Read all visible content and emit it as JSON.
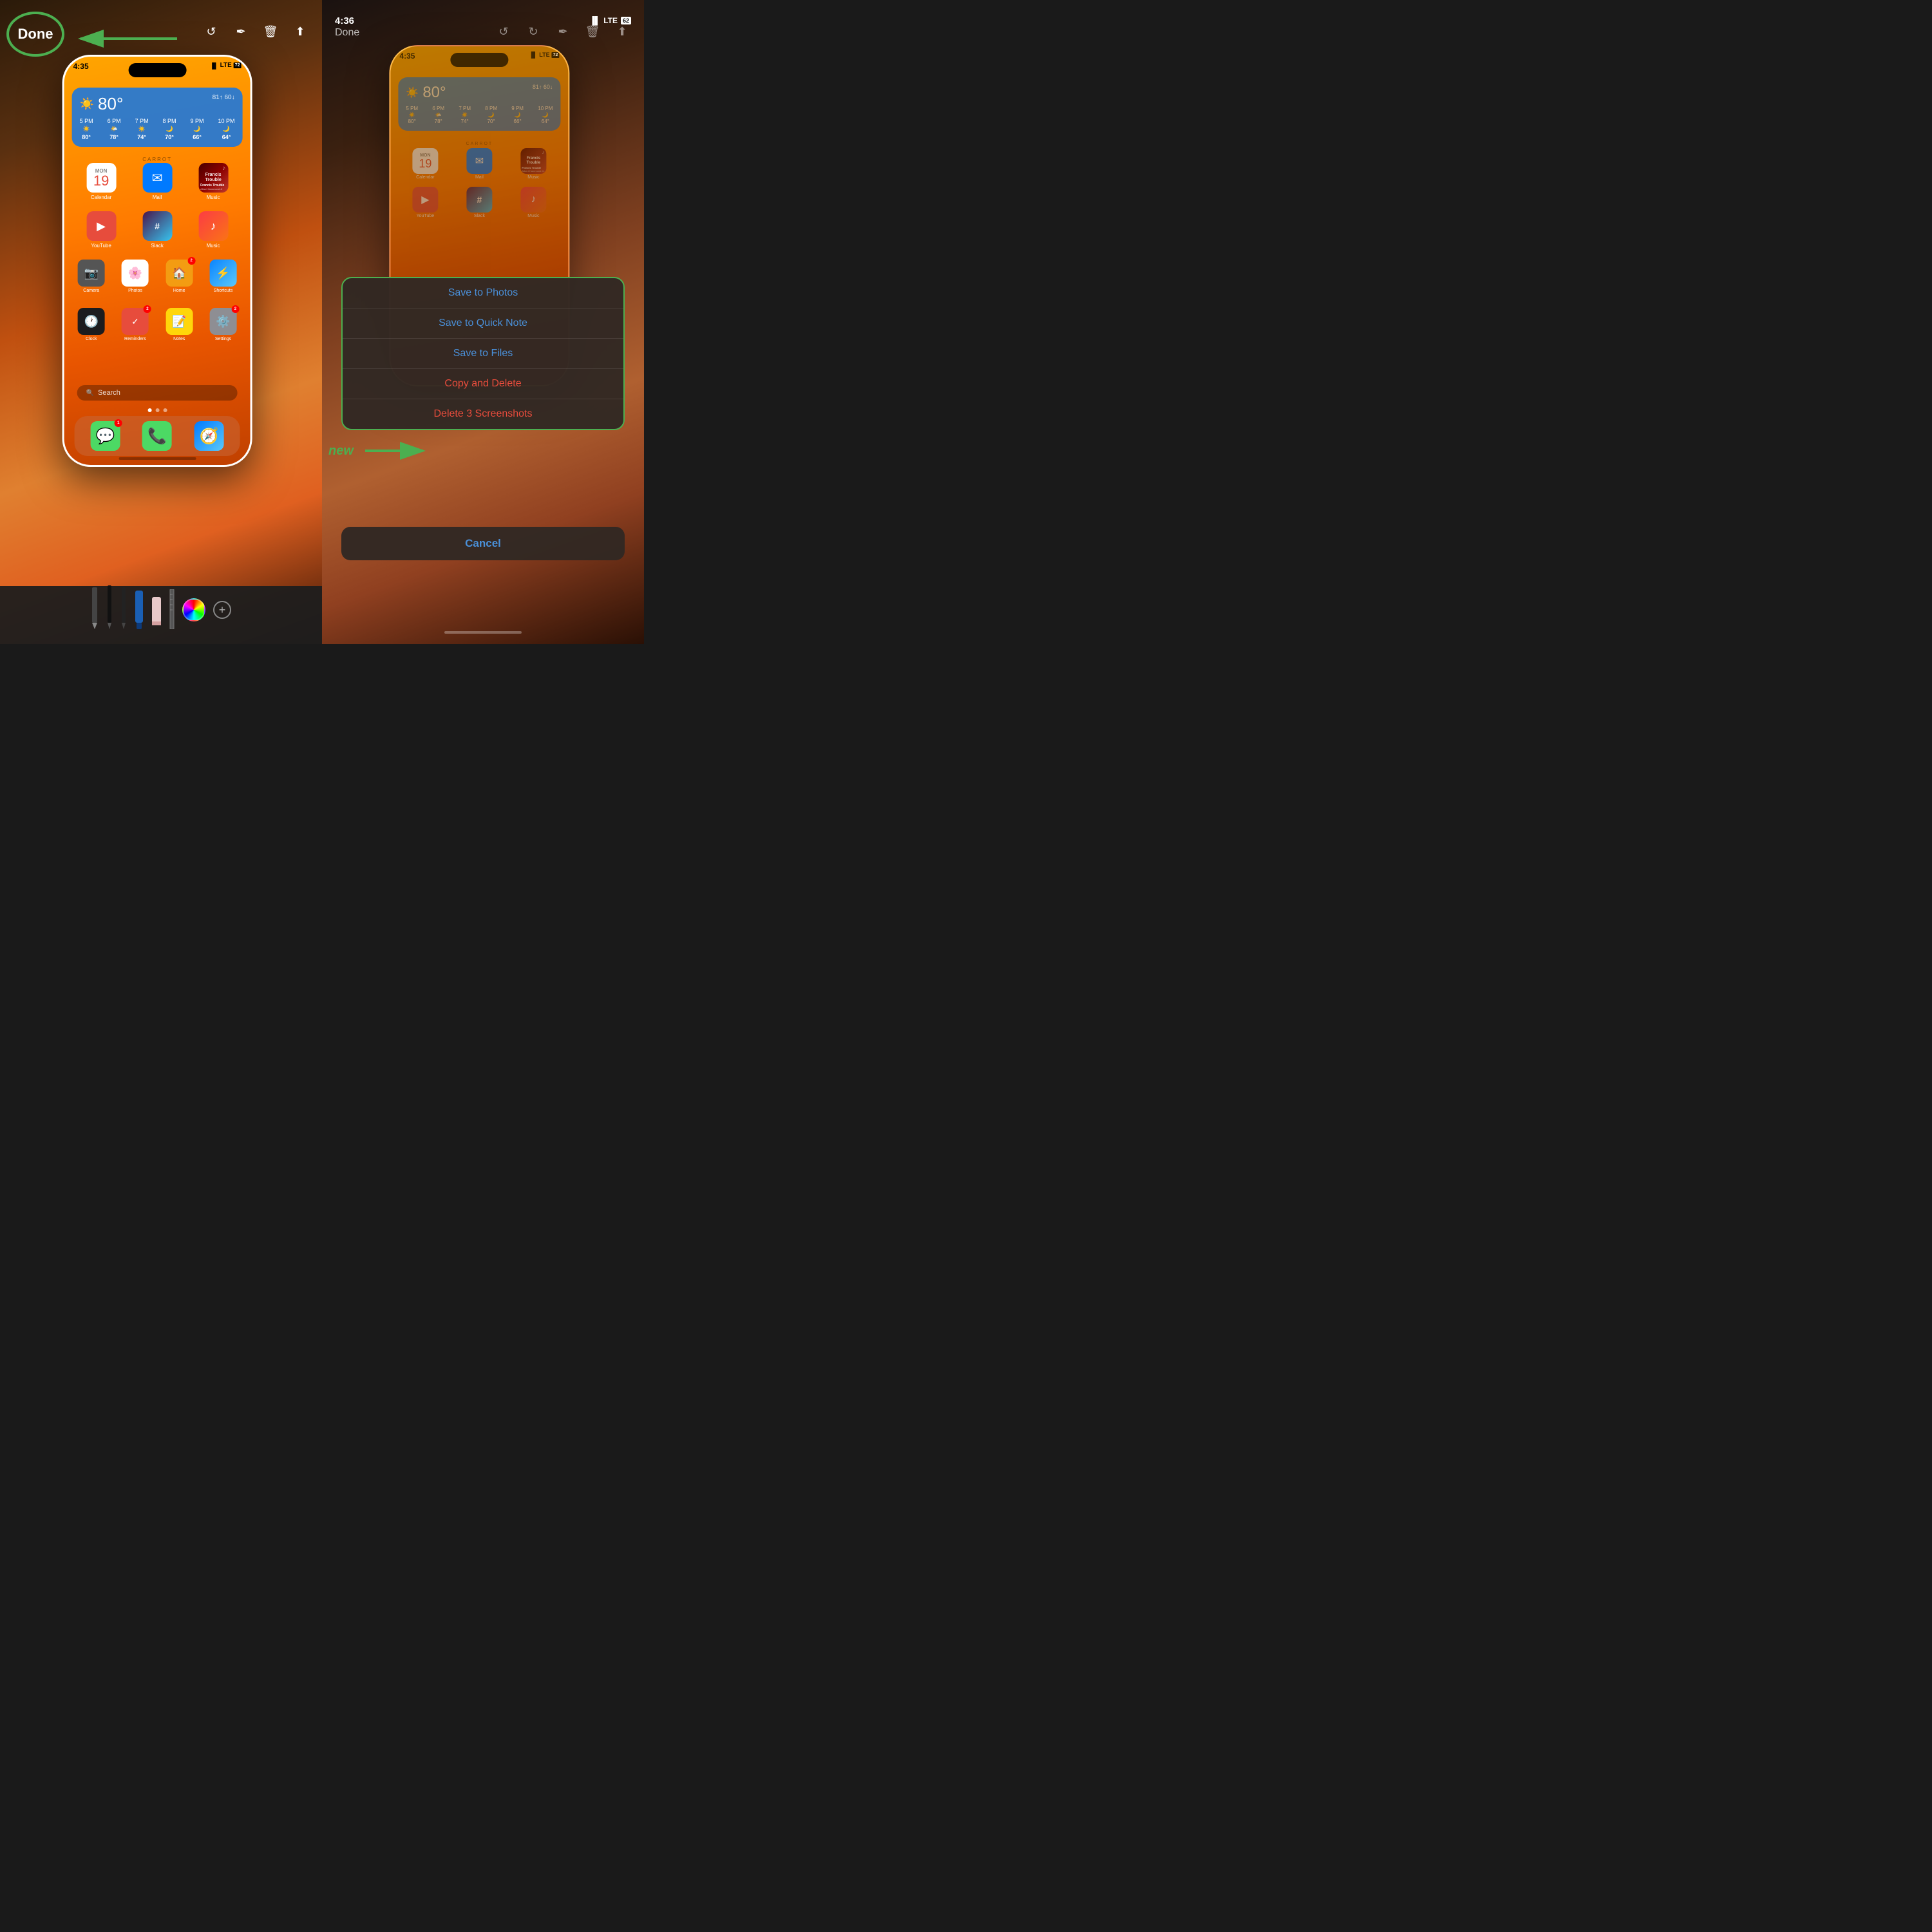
{
  "left_panel": {
    "status_time": "4:35",
    "status_signal": "LTE",
    "status_battery": "72",
    "toolbar": {
      "done_label": "Done",
      "icons": [
        "rotate-left",
        "pen",
        "trash",
        "share"
      ]
    },
    "done_circle_label": "Done",
    "phone": {
      "time": "4:35",
      "weather": {
        "temp": "80°",
        "icon": "☀️",
        "high": "81↑",
        "low": "60↓",
        "label": "CARROT",
        "forecast": [
          {
            "time": "5 PM",
            "icon": "☀️",
            "temp": "80°"
          },
          {
            "time": "6 PM",
            "icon": "🌤️",
            "temp": "78°"
          },
          {
            "time": "7 PM",
            "icon": "☀️",
            "temp": "74°"
          },
          {
            "time": "8 PM",
            "icon": "🌙",
            "temp": "70°"
          },
          {
            "time": "9 PM",
            "icon": "🌙",
            "temp": "66°"
          },
          {
            "time": "10 PM",
            "icon": "🌙",
            "temp": "64°"
          }
        ]
      },
      "apps_row1": [
        {
          "name": "Calendar",
          "label": "Calendar",
          "day": "MON",
          "num": "19"
        },
        {
          "name": "Mail",
          "label": "Mail"
        },
        {
          "name": "Music",
          "label": "Music",
          "song": "Francis Trouble",
          "artist": "Albert Hammond Jr"
        }
      ],
      "apps_row2": [
        {
          "name": "YouTube",
          "label": "YouTube"
        },
        {
          "name": "Slack",
          "label": "Slack"
        },
        {
          "name": "Music2",
          "label": "Music"
        }
      ],
      "apps_row3": [
        {
          "name": "Camera",
          "label": "Camera"
        },
        {
          "name": "Photos",
          "label": "Photos"
        },
        {
          "name": "Home",
          "label": "Home",
          "badge": "2"
        },
        {
          "name": "Shortcuts",
          "label": "Shortcuts"
        }
      ],
      "apps_row4": [
        {
          "name": "Clock",
          "label": "Clock"
        },
        {
          "name": "Reminders",
          "label": "Reminders",
          "badge": "2"
        },
        {
          "name": "Notes",
          "label": "Notes"
        },
        {
          "name": "Settings",
          "label": "Settings",
          "badge": "2"
        }
      ],
      "search_placeholder": "Search",
      "dock": [
        "Messages",
        "Phone",
        "Safari"
      ]
    },
    "drawing_tools": [
      "pencil",
      "pen1",
      "pen2",
      "marker",
      "eraser",
      "ruler"
    ],
    "color_wheel_label": "color-wheel",
    "plus_label": "+"
  },
  "right_panel": {
    "status_time": "4:36",
    "status_signal": "LTE",
    "status_battery": "62",
    "toolbar": {
      "done_label": "Done",
      "icons": [
        "rotate-left",
        "rotate-right",
        "pen",
        "trash",
        "share"
      ]
    },
    "phone": {
      "time": "4:35",
      "weather": {
        "temp": "80°",
        "high": "81↑",
        "low": "60↓",
        "label": "CARROT"
      }
    },
    "context_menu": {
      "items": [
        {
          "label": "Save to Photos",
          "style": "blue"
        },
        {
          "label": "Save to Quick Note",
          "style": "blue"
        },
        {
          "label": "Save to Files",
          "style": "blue"
        },
        {
          "label": "Copy and Delete",
          "style": "destructive"
        },
        {
          "label": "Delete 3 Screenshots",
          "style": "destructive"
        }
      ],
      "cancel_label": "Cancel"
    },
    "new_label": "new",
    "arrow_label": "→"
  }
}
